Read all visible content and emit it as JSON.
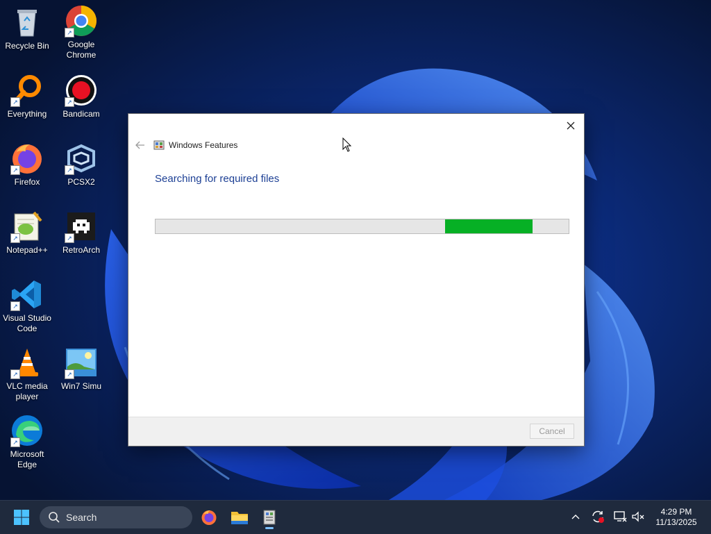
{
  "desktop": {
    "icons": [
      {
        "label": "Recycle Bin"
      },
      {
        "label": "Google Chrome"
      },
      {
        "label": "Everything"
      },
      {
        "label": "Bandicam"
      },
      {
        "label": "Firefox"
      },
      {
        "label": "PCSX2"
      },
      {
        "label": "Notepad++"
      },
      {
        "label": "RetroArch"
      },
      {
        "label": "Visual Studio Code"
      },
      {
        "label": "VLC media player"
      },
      {
        "label": "Win7 Simu"
      },
      {
        "label": "Microsoft Edge"
      }
    ]
  },
  "dialog": {
    "title": "Windows Features",
    "heading": "Searching for required files",
    "progress": {
      "state": "indeterminate",
      "fill_color": "#06b025"
    },
    "cancel_label": "Cancel"
  },
  "taskbar": {
    "search_label": "Search",
    "apps": [
      "firefox-icon",
      "file-explorer-icon",
      "windows-features-icon"
    ],
    "clock": {
      "time": "4:29 PM",
      "date": "11/13/2025"
    }
  },
  "colors": {
    "accent": "#1c3f94",
    "progress": "#06b025",
    "taskbar": "#1f2a3d"
  }
}
